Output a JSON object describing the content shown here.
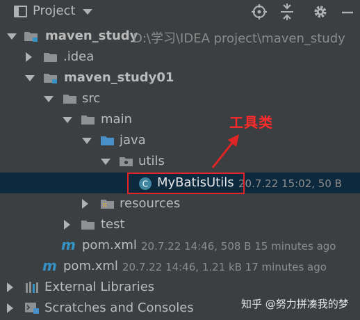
{
  "header": {
    "title": "Project",
    "icons": [
      "panel-icon",
      "locate-target-icon",
      "collapse-all-icon",
      "gear-icon",
      "minimize-icon"
    ]
  },
  "tree": {
    "root": {
      "name": "maven_study",
      "path": "D:\\学习\\IDEA project\\maven_study"
    },
    "idea": {
      "name": ".idea"
    },
    "module": {
      "name": "maven_study01"
    },
    "src": {
      "name": "src"
    },
    "main": {
      "name": "main"
    },
    "java": {
      "name": "java"
    },
    "utils": {
      "name": "utils"
    },
    "class_file": {
      "name": "MyBatisUtils",
      "meta": "20.7.22 15:02, 50 B"
    },
    "resources": {
      "name": "resources"
    },
    "test": {
      "name": "test"
    },
    "module_pom": {
      "name": "pom.xml",
      "meta": "20.7.22 14:46, 508 B 15 minutes ago"
    },
    "root_pom": {
      "name": "pom.xml",
      "meta": "20.7.22 14:46, 1.21 kB 17 minutes ago"
    },
    "external": {
      "name": "External Libraries"
    },
    "scratches": {
      "name": "Scratches and Consoles"
    }
  },
  "annotation": {
    "label": "工具类"
  },
  "watermark": {
    "text": "知乎 @努力拼凑我的梦"
  },
  "colors": {
    "background": "#3c3f41",
    "selection": "#0d293e",
    "text": "#bbbbbb",
    "meta": "#8c8c8c",
    "annotation": "#e32424",
    "module_badge": "#3592c4",
    "class_icon": "#3e86a0"
  }
}
